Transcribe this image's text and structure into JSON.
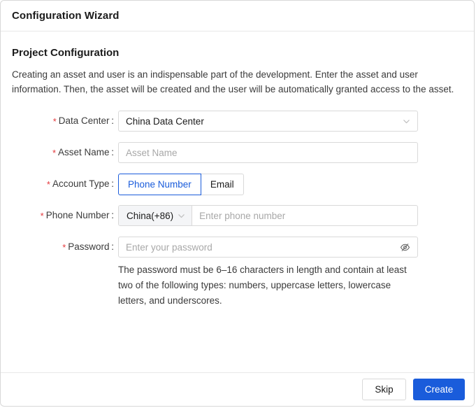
{
  "window": {
    "title": "Configuration Wizard"
  },
  "section": {
    "title": "Project Configuration",
    "description": "Creating an asset and user is an indispensable part of the development. Enter the asset and user information. Then, the asset will be created and the user will be automatically granted access to the asset."
  },
  "form": {
    "required_marker": "*",
    "data_center": {
      "label": "Data Center :",
      "value": "China Data Center",
      "icon": "chevron-down-icon"
    },
    "asset_name": {
      "label": "Asset Name :",
      "placeholder": "Asset Name",
      "value": ""
    },
    "account_type": {
      "label": "Account Type :",
      "options": [
        "Phone Number",
        "Email"
      ],
      "selected": "Phone Number"
    },
    "phone_number": {
      "label": "Phone Number :",
      "country": "China(+86)",
      "country_icon": "chevron-down-icon",
      "placeholder": "Enter phone number",
      "value": ""
    },
    "password": {
      "label": "Password :",
      "placeholder": "Enter your password",
      "value": "",
      "toggle_icon": "eye-off-icon",
      "hint": "The password must be 6–16 characters in length and contain at least two of the following types: numbers, uppercase letters, lowercase letters, and underscores."
    }
  },
  "footer": {
    "skip_label": "Skip",
    "create_label": "Create"
  },
  "colors": {
    "accent": "#1a5cdb",
    "required_star": "#e4393c",
    "border": "#d9d9d9",
    "placeholder": "#a8a8a8"
  }
}
